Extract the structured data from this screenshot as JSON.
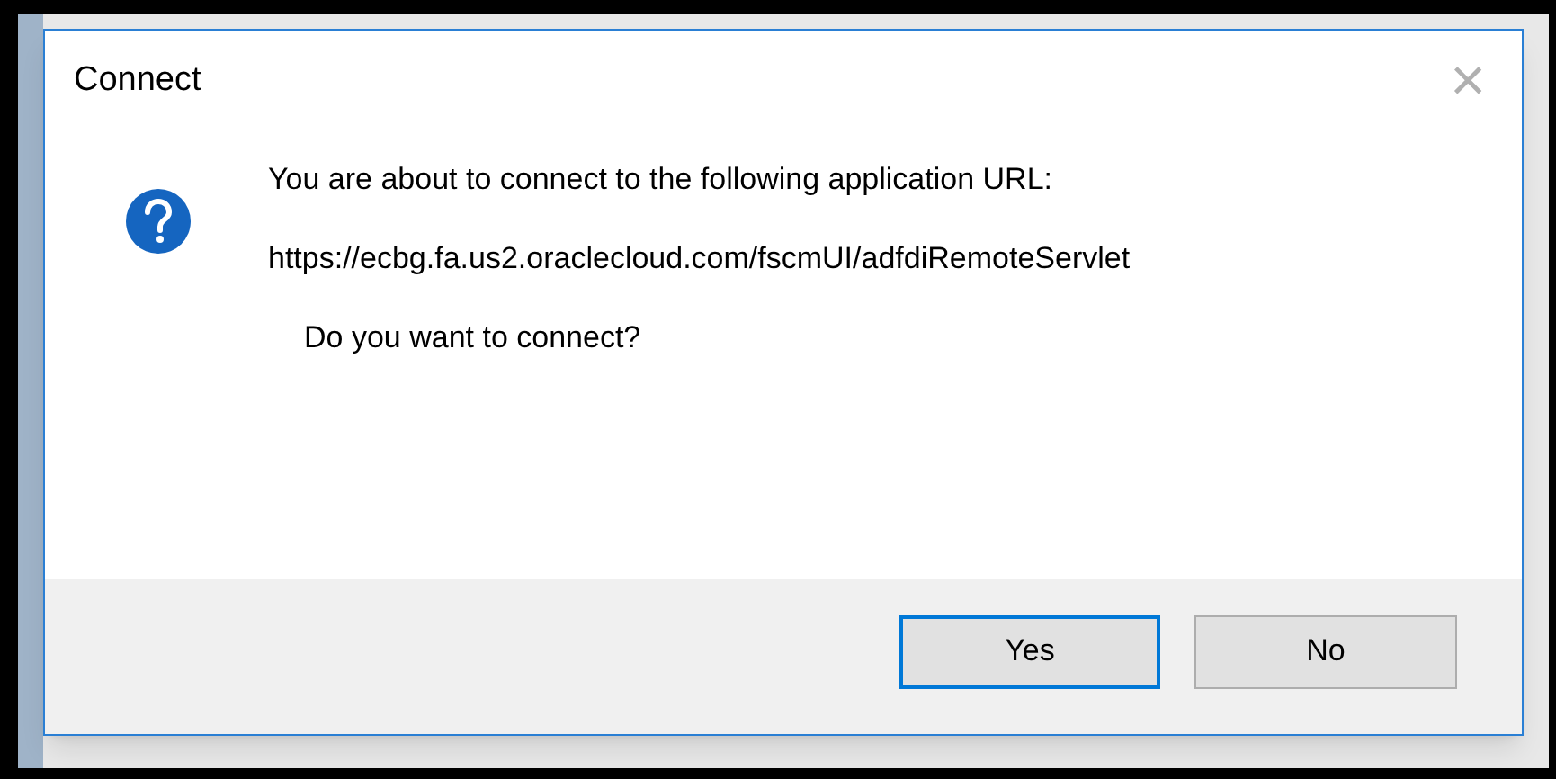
{
  "dialog": {
    "title": "Connect",
    "close": "×",
    "message": "You are about to connect to the following application URL:",
    "url": "https://ecbg.fa.us2.oraclecloud.com/fscmUI/adfdiRemoteServlet",
    "question": "Do you want to connect?"
  },
  "buttons": [
    {
      "label": "Yes",
      "selected": true
    },
    {
      "label": "No",
      "selected": false
    }
  ]
}
